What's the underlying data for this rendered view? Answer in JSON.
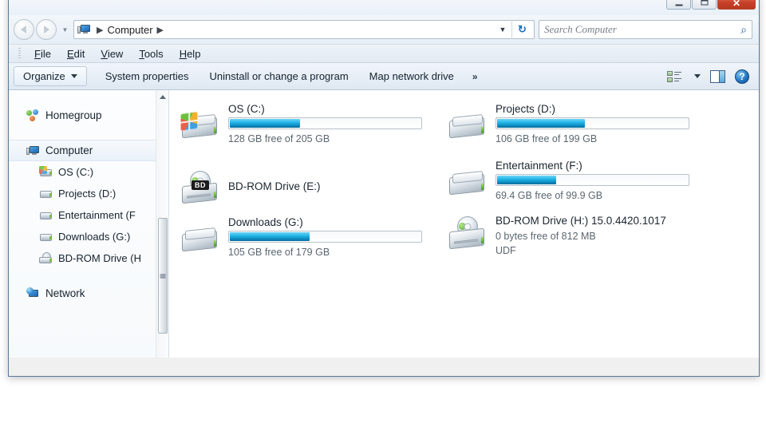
{
  "window": {
    "controls": [
      {
        "name": "minimize",
        "glyph": "—"
      },
      {
        "name": "maximize",
        "glyph": "▭"
      },
      {
        "name": "close",
        "glyph": "✕"
      }
    ]
  },
  "address": {
    "root_label": "Computer",
    "separator": "▶",
    "dropdown_glyph": "▼",
    "refresh_glyph": "↻"
  },
  "search": {
    "placeholder": "Search Computer",
    "icon_glyph": "⌕"
  },
  "menubar": {
    "items": [
      {
        "accel": "F",
        "rest": "ile"
      },
      {
        "accel": "E",
        "rest": "dit"
      },
      {
        "accel": "V",
        "rest": "iew"
      },
      {
        "accel": "T",
        "rest": "ools"
      },
      {
        "accel": "H",
        "rest": "elp"
      }
    ]
  },
  "toolbar": {
    "organize_label": "Organize",
    "items": [
      "System properties",
      "Uninstall or change a program",
      "Map network drive"
    ],
    "overflow_label": "»",
    "help_glyph": "?"
  },
  "sidebar": {
    "items": [
      {
        "label": "Homegroup",
        "icon": "homegroup-icon",
        "level": "top",
        "selected": false
      },
      {
        "label": "Computer",
        "icon": "computer-icon",
        "level": "top",
        "selected": true
      },
      {
        "label": "OS (C:)",
        "icon": "hdd-windows-icon",
        "level": "child",
        "selected": false
      },
      {
        "label": "Projects (D:)",
        "icon": "hdd-icon",
        "level": "child",
        "selected": false
      },
      {
        "label": "Entertainment (F",
        "icon": "hdd-icon",
        "level": "child",
        "selected": false
      },
      {
        "label": "Downloads (G:)",
        "icon": "hdd-icon",
        "level": "child",
        "selected": false
      },
      {
        "label": "BD-ROM Drive (H",
        "icon": "optical-drive-icon",
        "level": "child",
        "selected": false
      },
      {
        "label": "Network",
        "icon": "network-icon",
        "level": "top",
        "selected": false
      }
    ]
  },
  "drives": [
    {
      "name": "OS (C:)",
      "icon": "hdd-windows-icon",
      "has_bar": true,
      "used_percent": 37,
      "capacity_text": "128 GB free of 205 GB",
      "extra_text": ""
    },
    {
      "name": "Projects (D:)",
      "icon": "hdd-icon",
      "has_bar": true,
      "used_percent": 46,
      "capacity_text": "106 GB free of 199 GB",
      "extra_text": ""
    },
    {
      "name": "BD-ROM Drive (E:)",
      "icon": "bd-rom-empty-icon",
      "has_bar": false,
      "used_percent": 0,
      "capacity_text": "",
      "extra_text": ""
    },
    {
      "name": "Entertainment (F:)",
      "icon": "hdd-icon",
      "has_bar": true,
      "used_percent": 31,
      "capacity_text": "69.4 GB free of 99.9 GB",
      "extra_text": ""
    },
    {
      "name": "Downloads (G:)",
      "icon": "hdd-icon",
      "has_bar": true,
      "used_percent": 42,
      "capacity_text": "105 GB free of 179 GB",
      "extra_text": ""
    },
    {
      "name": "BD-ROM Drive (H:) 15.0.4420.1017",
      "icon": "bd-rom-disc-icon",
      "has_bar": false,
      "used_percent": 0,
      "capacity_text": "0 bytes free of 812 MB",
      "extra_text": "UDF"
    }
  ],
  "colors": {
    "bar_fill": "#23b6e8",
    "close_button": "#c8412a",
    "selection": "#eaf1f8"
  }
}
